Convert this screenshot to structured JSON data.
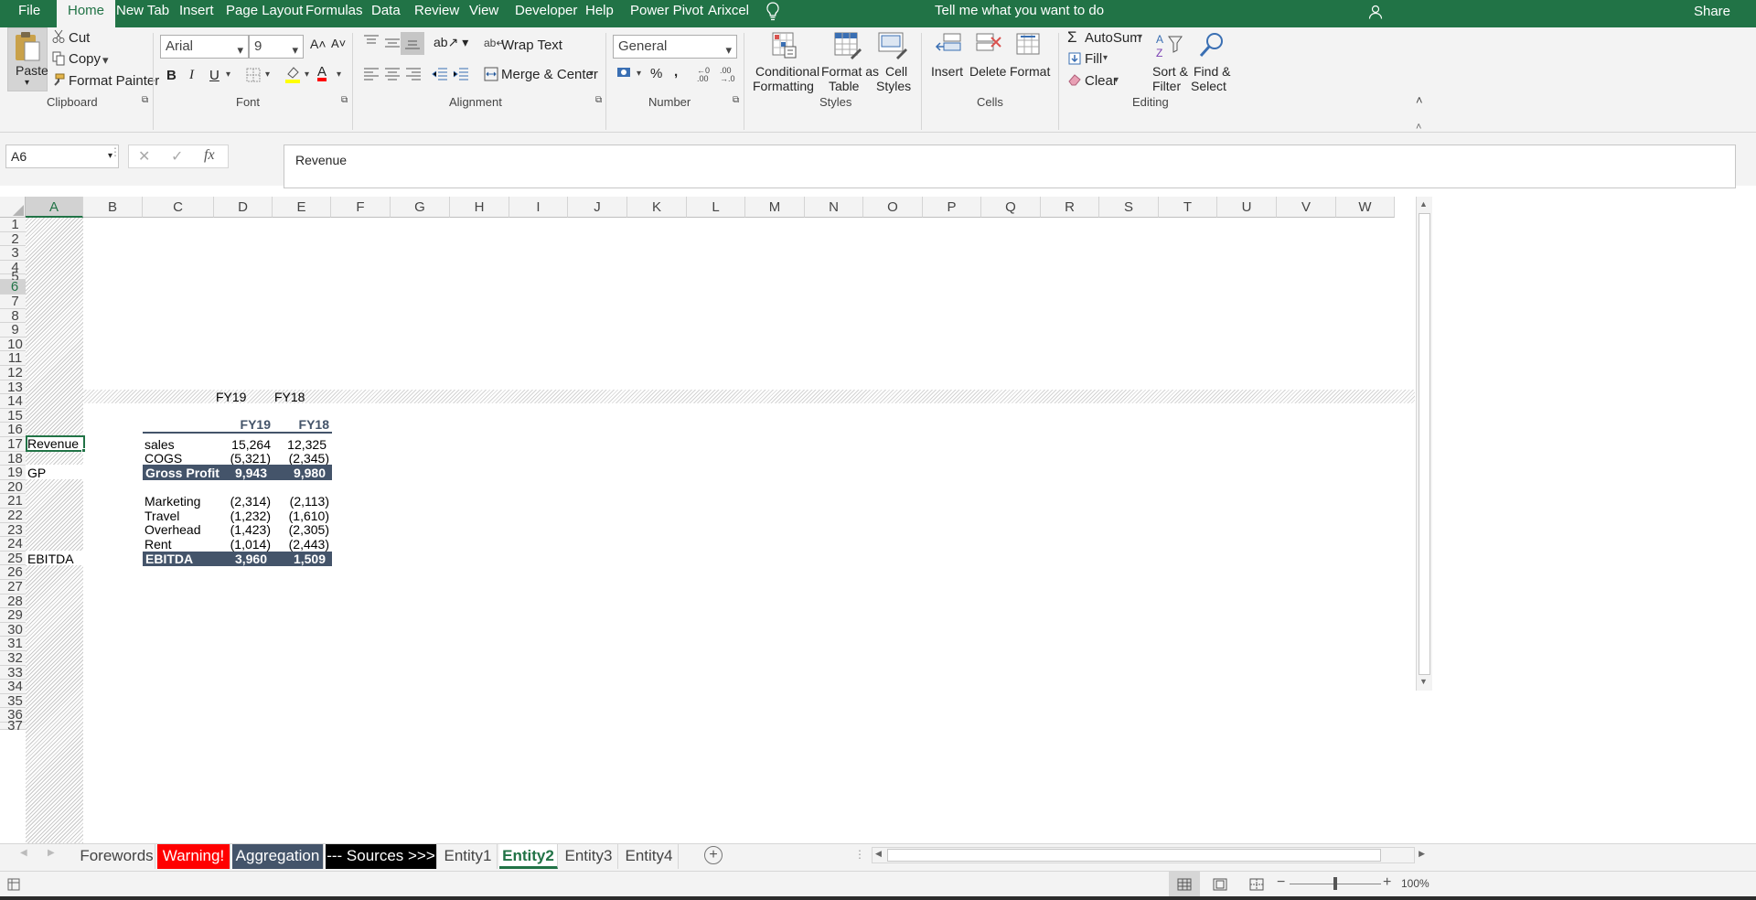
{
  "menu": {
    "file": "File",
    "tabs": [
      "Home",
      "New Tab",
      "Insert",
      "Page Layout",
      "Formulas",
      "Data",
      "Review",
      "View",
      "Developer",
      "Help",
      "Power Pivot",
      "Arixcel"
    ],
    "tell_me": "Tell me what you want to do",
    "share": "Share"
  },
  "ribbon": {
    "clipboard": {
      "paste": "Paste",
      "cut": "Cut",
      "copy": "Copy",
      "format_painter": "Format Painter",
      "label": "Clipboard"
    },
    "font": {
      "name": "Arial",
      "size": "9",
      "label": "Font"
    },
    "alignment": {
      "wrap_text": "Wrap Text",
      "merge_center": "Merge & Center",
      "label": "Alignment"
    },
    "number": {
      "format": "General",
      "percent": "%",
      "comma": ",",
      "label": "Number"
    },
    "styles": {
      "conditional": [
        "Conditional",
        "Formatting"
      ],
      "format_table": [
        "Format as",
        "Table"
      ],
      "cell_styles": [
        "Cell",
        "Styles"
      ],
      "label": "Styles"
    },
    "cells": {
      "insert": "Insert",
      "delete": "Delete",
      "format": "Format",
      "label": "Cells"
    },
    "editing": {
      "autosum": "AutoSum",
      "fill": "Fill",
      "clear": "Clear",
      "sort_filter": [
        "Sort &",
        "Filter"
      ],
      "find_select": [
        "Find &",
        "Select"
      ],
      "label": "Editing"
    }
  },
  "formula_bar": {
    "name_box": "A6",
    "fx": "fx",
    "content": "Revenue"
  },
  "columns": [
    "A",
    "B",
    "C",
    "D",
    "E",
    "F",
    "G",
    "H",
    "I",
    "J",
    "K",
    "L",
    "M",
    "N",
    "O",
    "P",
    "Q",
    "R",
    "S",
    "T",
    "U",
    "V",
    "W"
  ],
  "rows": [
    "1",
    "2",
    "3",
    "4",
    "5",
    "6",
    "7",
    "8",
    "9",
    "10",
    "11",
    "12",
    "13",
    "14",
    "15",
    "16",
    "17",
    "18",
    "19",
    "20",
    "21",
    "22",
    "23",
    "24",
    "25",
    "26",
    "27",
    "28",
    "29",
    "30",
    "31",
    "32",
    "33",
    "34",
    "35",
    "36",
    "37"
  ],
  "selected_cell": {
    "col": "A",
    "row": "6"
  },
  "sheet": {
    "row2": {
      "d": "FY19",
      "e": "FY18"
    },
    "header": {
      "d": "FY19",
      "e": "FY18"
    },
    "labels_col_a": {
      "r6": "Revenue",
      "r8": "GP",
      "r14": "EBITDA"
    },
    "lines": [
      {
        "label": "sales",
        "fy19": "15,264",
        "fy18": "12,325"
      },
      {
        "label": "COGS",
        "fy19": "(5,321)",
        "fy18": "(2,345)"
      }
    ],
    "gross_profit": {
      "label": "Gross Profit",
      "fy19": "9,943",
      "fy18": "9,980"
    },
    "opex": [
      {
        "label": "Marketing",
        "fy19": "(2,314)",
        "fy18": "(2,113)"
      },
      {
        "label": "Travel",
        "fy19": "(1,232)",
        "fy18": "(1,610)"
      },
      {
        "label": "Overhead",
        "fy19": "(1,423)",
        "fy18": "(2,305)"
      },
      {
        "label": "Rent",
        "fy19": "(1,014)",
        "fy18": "(2,443)"
      }
    ],
    "ebitda": {
      "label": "EBITDA",
      "fy19": "3,960",
      "fy18": "1,509"
    }
  },
  "sheet_tabs": [
    {
      "name": "Forewords",
      "style": "normal"
    },
    {
      "name": "Warning!",
      "style": "red"
    },
    {
      "name": "Aggregation",
      "style": "slate"
    },
    {
      "name": "--- Sources >>>",
      "style": "black"
    },
    {
      "name": "Entity1",
      "style": "normal"
    },
    {
      "name": "Entity2",
      "style": "active"
    },
    {
      "name": "Entity3",
      "style": "normal"
    },
    {
      "name": "Entity4",
      "style": "normal"
    }
  ],
  "status": {
    "zoom": "100%"
  },
  "colors": {
    "accent": "#217346",
    "band": "#44546a",
    "warning_tab": "#ff0000",
    "aggregation_tab": "#44546a",
    "sources_tab": "#000000"
  }
}
